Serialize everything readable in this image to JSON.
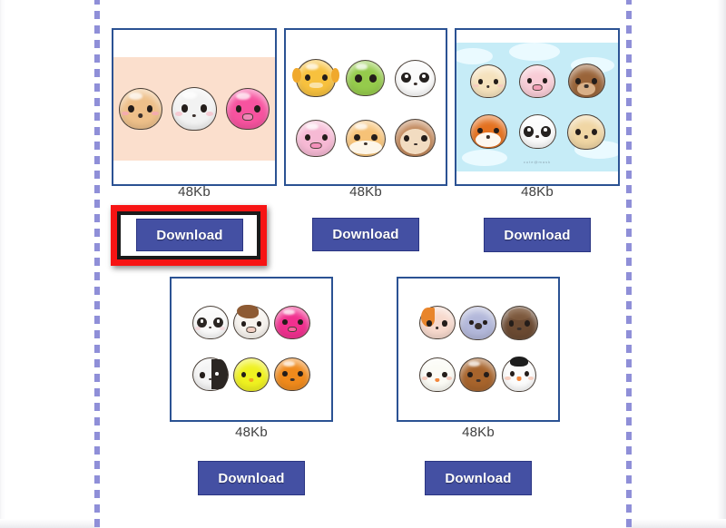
{
  "page": {
    "background_color": "#ffffff",
    "guide_color": "#8f8fd8",
    "card_border_color": "#2b5293",
    "button_color": "#4450a3",
    "highlight_color": "#f71414",
    "highlight_inner_color": "#1a1a1a"
  },
  "download_label": "Download",
  "cards": [
    {
      "id": "card-1",
      "size_label": "48Kb",
      "download_label": "Download",
      "highlighted": true,
      "thumbnail": {
        "name": "animal-faces-dog-rabbit-pig",
        "background": "#fbdfcd",
        "columns": 3,
        "rows": 1,
        "faces": [
          {
            "animal": "dog",
            "color": "#eec08a",
            "ear_color": "#b9813f",
            "blush": "#f6a7b6",
            "ears": "floppy"
          },
          {
            "animal": "rabbit",
            "color": "#f2f2f2",
            "ear_color": "#f7f7f7",
            "blush": "#f6c0cb",
            "ears": "long"
          },
          {
            "animal": "pig",
            "color": "#f7539f",
            "ear_color": "#f06ea8",
            "blush": "#f9a0c6",
            "ears": "pointy"
          }
        ]
      }
    },
    {
      "id": "card-2",
      "size_label": "48Kb",
      "download_label": "Download",
      "highlighted": false,
      "thumbnail": {
        "name": "animal-faces-giraffe-alien-panda-pig-cat-monkey",
        "background": "#ffffff",
        "columns": 3,
        "rows": 2,
        "faces": [
          {
            "animal": "giraffe",
            "color": "#f7c13e",
            "ear_color": "#f0a92d",
            "blush": "#f7a8a0",
            "ears": "horns"
          },
          {
            "animal": "alien",
            "color": "#95cb4c",
            "ear_color": "#7fb93c",
            "blush": "#a9d86a",
            "ears": "antennae"
          },
          {
            "animal": "panda",
            "color": "#fbfbfb",
            "ear_color": "#25211f",
            "blush": "#f0f0f0",
            "ears": "round"
          },
          {
            "animal": "pig",
            "color": "#f6b9d4",
            "ear_color": "#f2a3c6",
            "blush": "#f490bb",
            "ears": "pointy"
          },
          {
            "animal": "cat",
            "color": "#f6c277",
            "ear_color": "#eaa94f",
            "blush": "#f9f1e3",
            "ears": "pointy"
          },
          {
            "animal": "monkey",
            "color": "#f2dcc1",
            "ear_color": "#c1875a",
            "blush": "#eec9a7",
            "ears": "round"
          }
        ]
      }
    },
    {
      "id": "card-3",
      "size_label": "48Kb",
      "download_label": "Download",
      "highlighted": false,
      "thumbnail": {
        "name": "animal-faces-cat-pig-bear-fox-panda-lion",
        "background": "#c6ecf7",
        "watermark": "cute@mask",
        "columns": 3,
        "rows": 2,
        "faces": [
          {
            "animal": "cat",
            "color": "#f5e2bd",
            "ear_color": "#e8cb9b",
            "blush": "#f6c8c0",
            "ears": "pointy"
          },
          {
            "animal": "pig",
            "color": "#f8ccd6",
            "ear_color": "#f2b1c2",
            "blush": "#f39fb6",
            "ears": "pointy"
          },
          {
            "animal": "bear",
            "color": "#9a6439",
            "ear_color": "#7d5029",
            "blush": "#b87c4c",
            "ears": "round"
          },
          {
            "animal": "fox",
            "color": "#e4711f",
            "ear_color": "#c75e16",
            "blush": "#f2a05a",
            "ears": "pointy"
          },
          {
            "animal": "panda",
            "color": "#fbfbfb",
            "ear_color": "#25211f",
            "blush": "#efefef",
            "ears": "round"
          },
          {
            "animal": "lion",
            "color": "#f0d6a4",
            "ear_color": "#d8a855",
            "blush": "#eec288",
            "ears": "mane"
          }
        ]
      }
    },
    {
      "id": "card-4",
      "size_label": "48Kb",
      "download_label": "Download",
      "highlighted": false,
      "thumbnail": {
        "name": "animal-faces-panda-cow-pig-panda-chick-bear",
        "background": "#ffffff",
        "columns": 3,
        "rows": 2,
        "faces": [
          {
            "animal": "panda",
            "color": "#fafafa",
            "ear_color": "#2b2623",
            "blush": "#f5d4d9",
            "ears": "round"
          },
          {
            "animal": "cow",
            "color": "#f7f3ee",
            "ear_color": "#8d5a33",
            "blush": "#f1cfc2",
            "ears": "horns"
          },
          {
            "animal": "pig",
            "color": "#f1308f",
            "ear_color": "#e0207d",
            "blush": "#f7669f",
            "ears": "pointy"
          },
          {
            "animal": "panda",
            "color": "#f4f4f4",
            "ear_color": "#2b2623",
            "blush": "#e9e9e9",
            "ears": "round"
          },
          {
            "animal": "chick",
            "color": "#eff120",
            "ear_color": "#e2d417",
            "blush": "#f5f56a",
            "ears": "tuft"
          },
          {
            "animal": "bear",
            "color": "#f08a1c",
            "ear_color": "#d6750f",
            "blush": "#f5a94f",
            "ears": "round"
          }
        ]
      }
    },
    {
      "id": "card-5",
      "size_label": "48Kb",
      "download_label": "Download",
      "highlighted": false,
      "thumbnail": {
        "name": "animal-faces-cat-koala-bear-chicken-bear-penguin",
        "background": "#ffffff",
        "columns": 3,
        "rows": 2,
        "faces": [
          {
            "animal": "cat",
            "color": "#f7d9cd",
            "ear_color": "#e8852c",
            "blush": "#f2b7a6",
            "ears": "pointy"
          },
          {
            "animal": "koala",
            "color": "#b3b8da",
            "ear_color": "#c6cbe6",
            "blush": "#c9cde8",
            "ears": "round"
          },
          {
            "animal": "bear",
            "color": "#6b4a32",
            "ear_color": "#533722",
            "blush": "#8a6546",
            "ears": "round"
          },
          {
            "animal": "chicken",
            "color": "#fbfbf5",
            "ear_color": "#e54b2a",
            "blush": "#f7c0b0",
            "ears": "comb"
          },
          {
            "animal": "bear",
            "color": "#a7642c",
            "ear_color": "#8a4f1e",
            "blush": "#c48249",
            "ears": "round"
          },
          {
            "animal": "penguin",
            "color": "#fcfcfc",
            "ear_color": "#1d1d1d",
            "blush": "#f6c3b2",
            "ears": "none"
          }
        ]
      }
    }
  ]
}
